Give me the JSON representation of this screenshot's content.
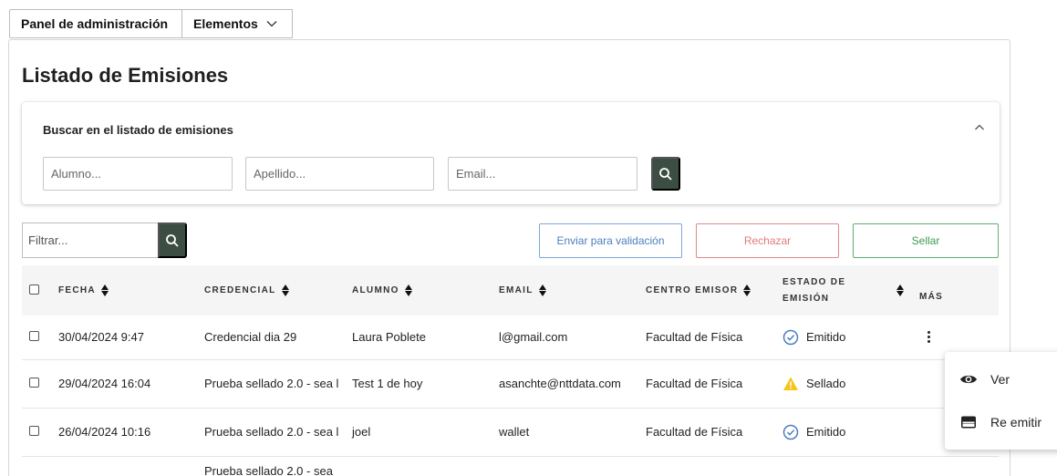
{
  "nav": {
    "panel_label": "Panel de administración",
    "elements_label": "Elementos"
  },
  "page": {
    "title": "Listado de Emisiones"
  },
  "search": {
    "title": "Buscar en el listado de emisiones",
    "alumno_placeholder": "Alumno...",
    "apellido_placeholder": "Apellido...",
    "email_placeholder": "Email..."
  },
  "filter": {
    "placeholder": "Filtrar..."
  },
  "actions": {
    "validate": "Enviar para validación",
    "reject": "Rechazar",
    "seal": "Sellar"
  },
  "table": {
    "headers": {
      "fecha": "FECHA",
      "credencial": "CREDENCIAL",
      "alumno": "ALUMNO",
      "email": "EMAIL",
      "centro": "CENTRO EMISOR",
      "estado_line1": "ESTADO DE",
      "estado_line2": "EMISIÓN",
      "mas": "MÁS"
    },
    "rows": [
      {
        "fecha": "30/04/2024 9:47",
        "credencial": "Credencial dia 29",
        "alumno": "Laura Poblete",
        "email": "l@gmail.com",
        "centro": "Facultad de Física",
        "estado": "Emitido"
      },
      {
        "fecha": "29/04/2024 16:04",
        "credencial": "Prueba sellado 2.0 - sea l",
        "alumno": "Test 1 de hoy",
        "email": "asanchte@nttdata.com",
        "centro": "Facultad de Física",
        "estado": "Sellado"
      },
      {
        "fecha": "26/04/2024 10:16",
        "credencial": "Prueba sellado 2.0 - sea l",
        "alumno": "joel",
        "email": "wallet",
        "centro": "Facultad de Física",
        "estado": "Emitido"
      },
      {
        "fecha": "",
        "credencial": "Prueba sellado 2.0 - sea",
        "alumno": "",
        "email": "",
        "centro": "",
        "estado": ""
      }
    ]
  },
  "menu": {
    "items": [
      {
        "label": "Ver",
        "icon": "eye-icon"
      },
      {
        "label": "Re emitir",
        "icon": "card-icon"
      }
    ]
  },
  "colors": {
    "dark_green": "#3c4d43",
    "status_check_blue": "#4a7fc1",
    "status_warn_yellow": "#f5c518",
    "reject_red": "#e07b7b",
    "seal_green": "#3f9a52"
  }
}
